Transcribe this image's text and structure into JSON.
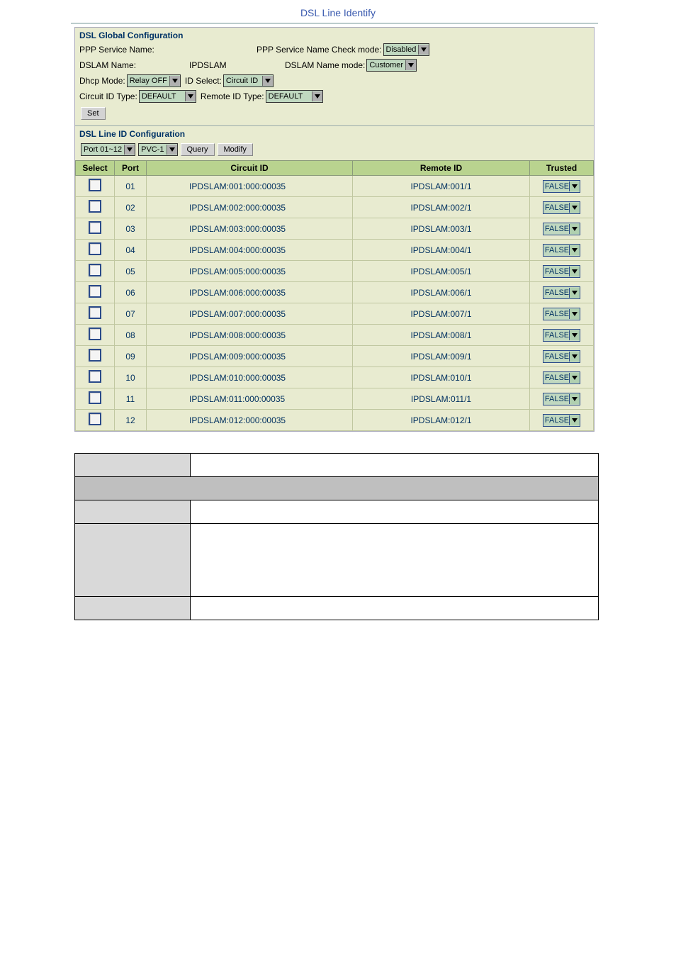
{
  "page_title": "DSL Line Identify",
  "global": {
    "heading": "DSL Global Configuration",
    "ppp_service_name_label": "PPP Service Name:",
    "ppp_service_name_value": "",
    "ppp_check_mode_label": "PPP Service Name Check mode:",
    "ppp_check_mode_value": "Disabled",
    "dslam_name_label": "DSLAM Name:",
    "dslam_name_value": "IPDSLAM",
    "dslam_name_mode_label": "DSLAM Name mode:",
    "dslam_name_mode_value": "Customer",
    "dhcp_mode_label": "Dhcp Mode:",
    "dhcp_mode_value": "Relay OFF",
    "id_select_label": "ID Select:",
    "id_select_value": "Circuit ID",
    "circuit_id_type_label": "Circuit ID Type:",
    "circuit_id_type_value": "DEFAULT",
    "remote_id_type_label": "Remote ID Type:",
    "remote_id_type_value": "DEFAULT",
    "set_button": "Set"
  },
  "lineid": {
    "heading": "DSL Line ID Configuration",
    "port_range_value": "Port 01~12",
    "pvc_value": "PVC-1",
    "query_button": "Query",
    "modify_button": "Modify"
  },
  "table": {
    "headers": {
      "select": "Select",
      "port": "Port",
      "circuit": "Circuit ID",
      "remote": "Remote ID",
      "trusted": "Trusted"
    },
    "rows": [
      {
        "port": "01",
        "circuit": "IPDSLAM:001:000:00035",
        "remote": "IPDSLAM:001/1",
        "trusted": "FALSE"
      },
      {
        "port": "02",
        "circuit": "IPDSLAM:002:000:00035",
        "remote": "IPDSLAM:002/1",
        "trusted": "FALSE"
      },
      {
        "port": "03",
        "circuit": "IPDSLAM:003:000:00035",
        "remote": "IPDSLAM:003/1",
        "trusted": "FALSE"
      },
      {
        "port": "04",
        "circuit": "IPDSLAM:004:000:00035",
        "remote": "IPDSLAM:004/1",
        "trusted": "FALSE"
      },
      {
        "port": "05",
        "circuit": "IPDSLAM:005:000:00035",
        "remote": "IPDSLAM:005/1",
        "trusted": "FALSE"
      },
      {
        "port": "06",
        "circuit": "IPDSLAM:006:000:00035",
        "remote": "IPDSLAM:006/1",
        "trusted": "FALSE"
      },
      {
        "port": "07",
        "circuit": "IPDSLAM:007:000:00035",
        "remote": "IPDSLAM:007/1",
        "trusted": "FALSE"
      },
      {
        "port": "08",
        "circuit": "IPDSLAM:008:000:00035",
        "remote": "IPDSLAM:008/1",
        "trusted": "FALSE"
      },
      {
        "port": "09",
        "circuit": "IPDSLAM:009:000:00035",
        "remote": "IPDSLAM:009/1",
        "trusted": "FALSE"
      },
      {
        "port": "10",
        "circuit": "IPDSLAM:010:000:00035",
        "remote": "IPDSLAM:010/1",
        "trusted": "FALSE"
      },
      {
        "port": "11",
        "circuit": "IPDSLAM:011:000:00035",
        "remote": "IPDSLAM:011/1",
        "trusted": "FALSE"
      },
      {
        "port": "12",
        "circuit": "IPDSLAM:012:000:00035",
        "remote": "IPDSLAM:012/1",
        "trusted": "FALSE"
      }
    ]
  }
}
